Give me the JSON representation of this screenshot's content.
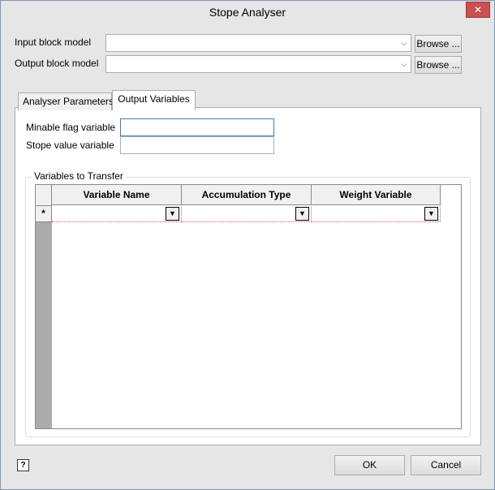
{
  "window": {
    "title": "Stope Analyser",
    "close_glyph": "✕"
  },
  "inputs": {
    "input_block_model_label": "Input block model",
    "output_block_model_label": "Output block model",
    "input_block_model_value": "",
    "output_block_model_value": "",
    "browse_label": "Browse ..."
  },
  "tabs": [
    {
      "label": "Analyser Parameters",
      "active": false
    },
    {
      "label": "Output Variables",
      "active": true
    }
  ],
  "output_variables": {
    "minable_flag_label": "Minable flag variable",
    "minable_flag_value": "",
    "stope_value_label": "Stope value variable",
    "stope_value_value": ""
  },
  "transfer": {
    "group_title": "Variables to Transfer",
    "columns": [
      "Variable Name",
      "Accumulation Type",
      "Weight Variable"
    ],
    "new_row_marker": "*",
    "rows": [
      {
        "variable_name": "",
        "accumulation_type": "",
        "weight_variable": ""
      }
    ]
  },
  "footer": {
    "ok_label": "OK",
    "cancel_label": "Cancel",
    "help_glyph": "?"
  },
  "colors": {
    "accent": "#3c7fb1",
    "close": "#c75050",
    "window_bg": "#e6e6e6"
  }
}
